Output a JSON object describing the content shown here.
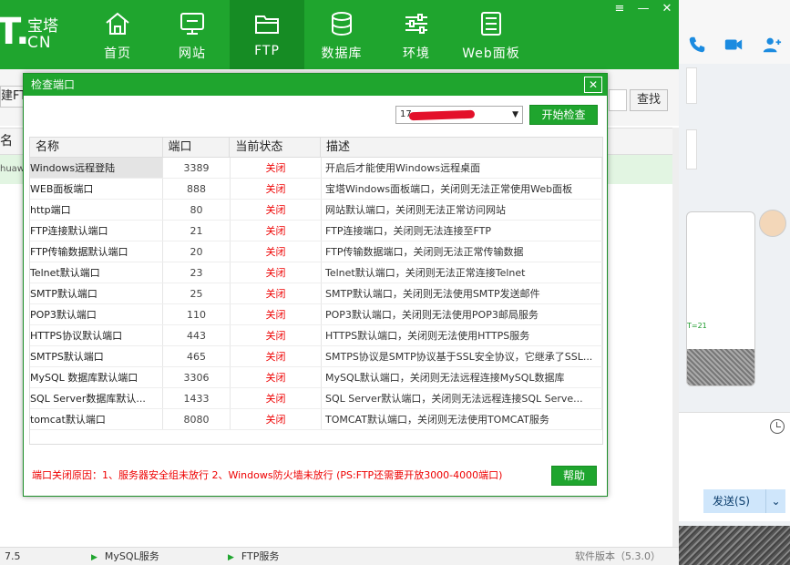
{
  "app": {
    "logo": {
      "t": "T.",
      "cn1": "宝塔",
      "cn2": "CN"
    },
    "nav": [
      {
        "label": "首页",
        "icon": "home-icon"
      },
      {
        "label": "网站",
        "icon": "monitor-icon"
      },
      {
        "label": "FTP",
        "icon": "folder-icon",
        "active": true
      },
      {
        "label": "数据库",
        "icon": "database-icon"
      },
      {
        "label": "环境",
        "icon": "sliders-icon"
      },
      {
        "label": "Web面板",
        "icon": "document-icon"
      }
    ],
    "window_controls": [
      "≡",
      "—",
      "✕"
    ],
    "create_button_label": "建FT",
    "search_button_label": "查找",
    "bg_table_head": "名",
    "bg_table_row": "huawa",
    "statusbar": {
      "item1": "7.5",
      "item2": "MySQL服务",
      "item3": "FTP服务",
      "version": "软件版本（5.3.0）"
    },
    "accent_color": "#1fa52e"
  },
  "dialog": {
    "title": "检查端口",
    "close_label": "✕",
    "ip_value": "17",
    "start_button": "开始检查",
    "columns": [
      "名称",
      "端口",
      "当前状态",
      "描述"
    ],
    "rows": [
      {
        "name": "Windows远程登陆",
        "port": "3389",
        "status": "关闭",
        "desc": "开启后才能使用Windows远程桌面"
      },
      {
        "name": "WEB面板端口",
        "port": "888",
        "status": "关闭",
        "desc": "宝塔Windows面板端口，关闭则无法正常使用Web面板"
      },
      {
        "name": "http端口",
        "port": "80",
        "status": "关闭",
        "desc": "网站默认端口，关闭则无法正常访问网站"
      },
      {
        "name": "FTP连接默认端口",
        "port": "21",
        "status": "关闭",
        "desc": "FTP连接端口，关闭则无法连接至FTP"
      },
      {
        "name": "FTP传输数据默认端口",
        "port": "20",
        "status": "关闭",
        "desc": "FTP传输数据端口，关闭则无法正常传输数据"
      },
      {
        "name": "Telnet默认端口",
        "port": "23",
        "status": "关闭",
        "desc": "Telnet默认端口，关闭则无法正常连接Telnet"
      },
      {
        "name": "SMTP默认端口",
        "port": "25",
        "status": "关闭",
        "desc": "SMTP默认端口，关闭则无法使用SMTP发送邮件"
      },
      {
        "name": "POP3默认端口",
        "port": "110",
        "status": "关闭",
        "desc": "POP3默认端口，关闭则无法使用POP3邮局服务"
      },
      {
        "name": "HTTPS协议默认端口",
        "port": "443",
        "status": "关闭",
        "desc": "HTTPS默认端口，关闭则无法使用HTTPS服务"
      },
      {
        "name": "SMTPS默认端口",
        "port": "465",
        "status": "关闭",
        "desc": "SMTPS协议是SMTP协议基于SSL安全协议，它继承了SSL..."
      },
      {
        "name": "MySQL 数据库默认端口",
        "port": "3306",
        "status": "关闭",
        "desc": "MySQL默认端口，关闭则无法远程连接MySQL数据库"
      },
      {
        "name": "SQL Server数据库默认...",
        "port": "1433",
        "status": "关闭",
        "desc": "SQL Server默认端口，关闭则无法远程连接SQL Serve..."
      },
      {
        "name": "tomcat默认端口",
        "port": "8080",
        "status": "关闭",
        "desc": "TOMCAT默认端口，关闭则无法使用TOMCAT服务"
      }
    ],
    "reason": "端口关闭原因：1、服务器安全组未放行  2、Windows防火墙未放行  (PS:FTP还需要开放3000-4000端口)",
    "help_button": "帮助"
  },
  "chat": {
    "image_text": "T=21",
    "send_button": "发送(S)",
    "send_dropdown": "⌄"
  }
}
